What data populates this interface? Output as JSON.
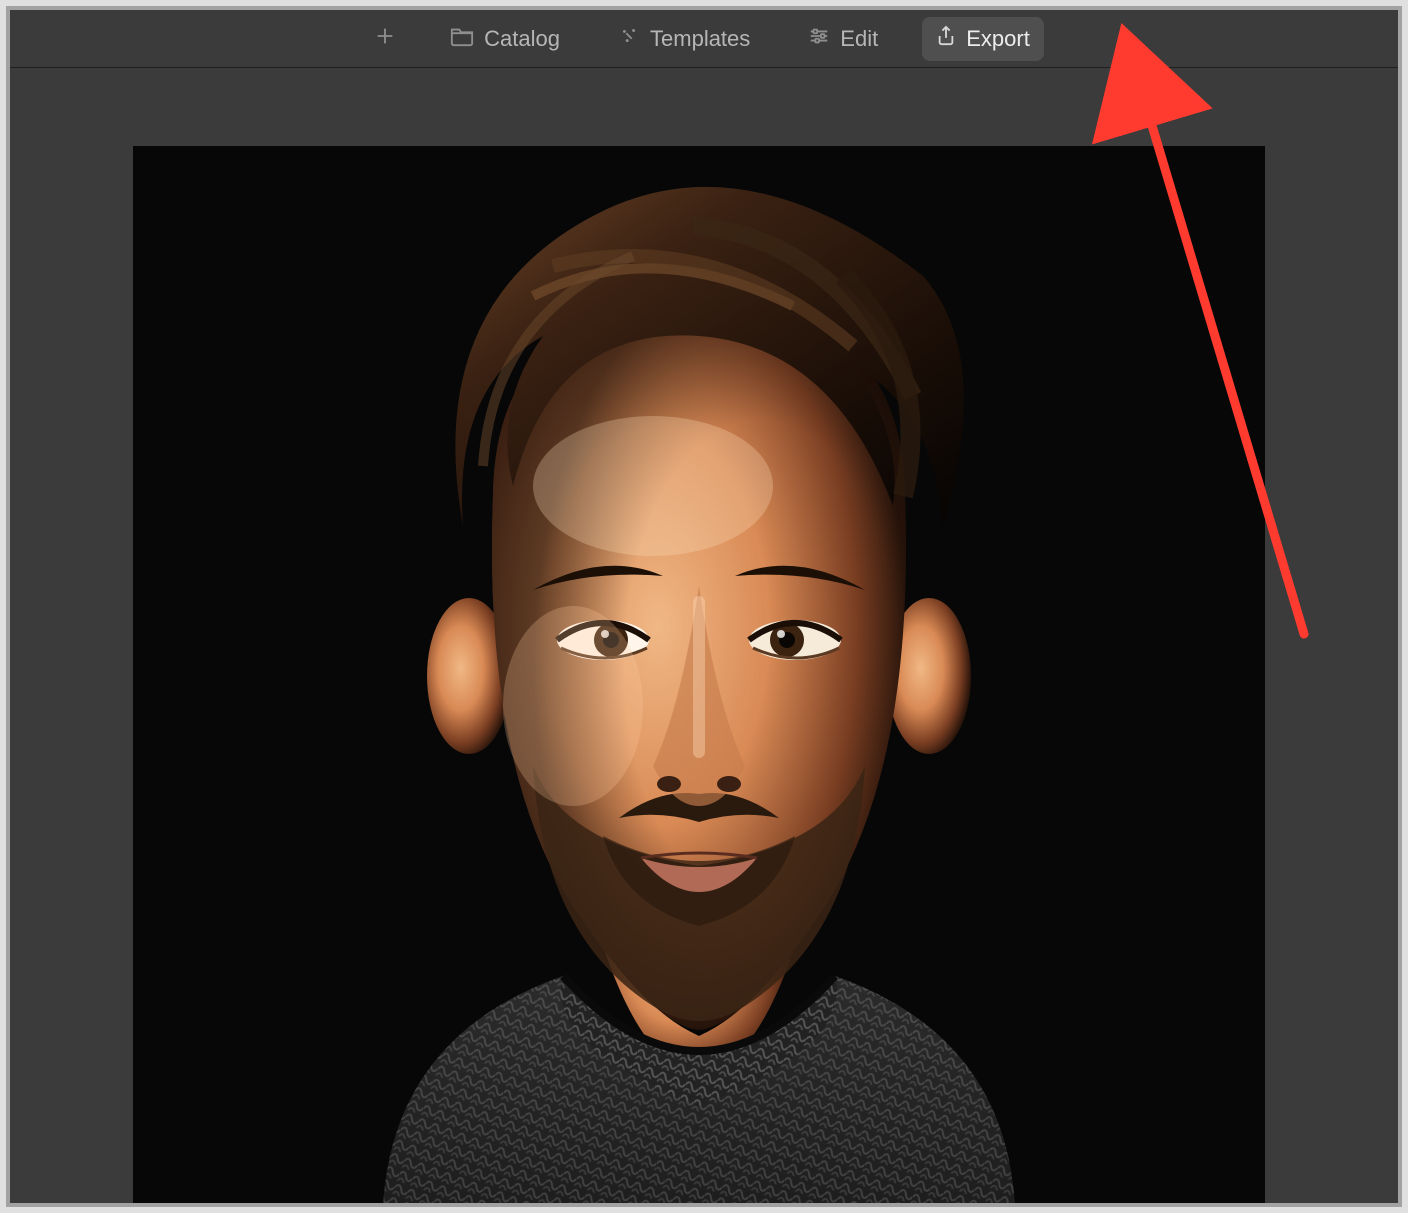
{
  "topbar": {
    "add_label": "",
    "catalog_label": "Catalog",
    "templates_label": "Templates",
    "edit_label": "Edit",
    "export_label": "Export"
  },
  "canvas": {
    "content_description": "Dramatic studio portrait of a young man with combed wavy brown hair, trimmed beard, wearing a dark grey knitted turtleneck, on a black background"
  },
  "annotation": {
    "target": "export-button",
    "color": "#ff3b30"
  }
}
